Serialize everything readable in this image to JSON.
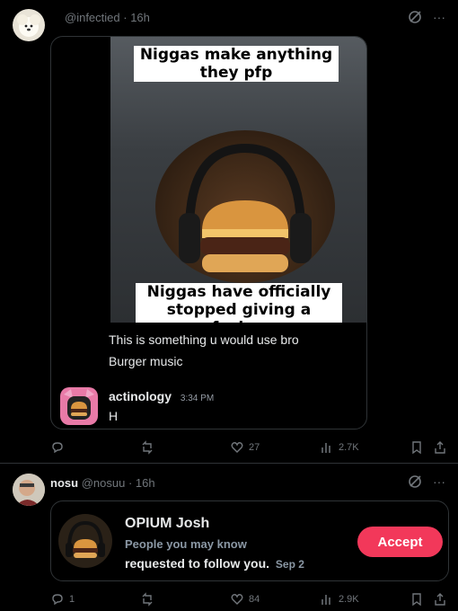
{
  "post1": {
    "handle": "@infectied",
    "time": "16h",
    "caption_top": "Niggas make anything they pfp",
    "caption_bottom": "Niggas have officially stopped giving a fuck...",
    "message1": "This is something u would use bro",
    "message2": "Burger music",
    "reply_user": "actinology",
    "reply_time": "3:34 PM",
    "reply_text": "H",
    "likes": "27",
    "views": "2.7K"
  },
  "post2": {
    "name": "nosu",
    "handle": "@nosuu",
    "time": "16h",
    "card_title": "OPIUM Josh",
    "card_subtitle": "People you may know",
    "card_action": "requested to follow you.",
    "card_date": "Sep 2",
    "accept_label": "Accept",
    "replies": "1",
    "likes": "84",
    "views": "2.9K"
  },
  "colors": {
    "accent": "#f2385a",
    "muted": "#71767b",
    "border": "#2f3336"
  },
  "icons": [
    "reply-icon",
    "retweet-icon",
    "like-icon",
    "views-icon",
    "bookmark-icon",
    "share-icon",
    "grok-icon",
    "more-icon"
  ]
}
